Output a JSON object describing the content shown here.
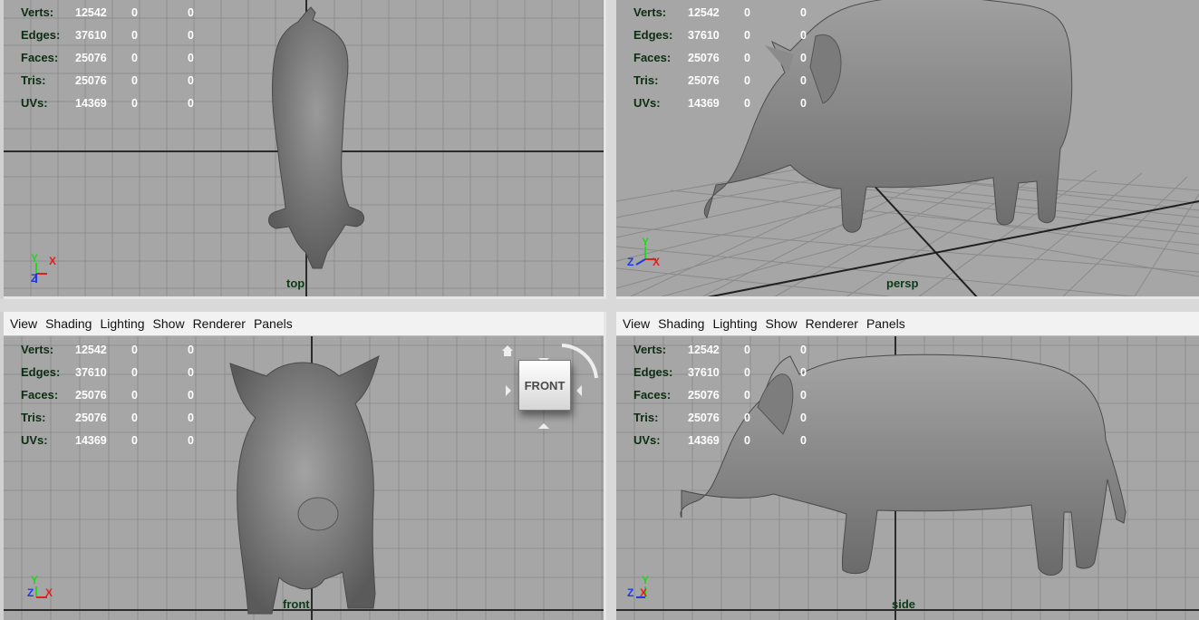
{
  "stats": [
    {
      "label": "Verts:",
      "v1": "12542",
      "v2": "0",
      "v3": "0"
    },
    {
      "label": "Edges:",
      "v1": "37610",
      "v2": "0",
      "v3": "0"
    },
    {
      "label": "Faces:",
      "v1": "25076",
      "v2": "0",
      "v3": "0"
    },
    {
      "label": "Tris:",
      "v1": "25076",
      "v2": "0",
      "v3": "0"
    },
    {
      "label": "UVs:",
      "v1": "14369",
      "v2": "0",
      "v3": "0"
    }
  ],
  "menu": [
    "View",
    "Shading",
    "Lighting",
    "Show",
    "Renderer",
    "Panels"
  ],
  "viewports": {
    "top": {
      "camera": "top"
    },
    "persp": {
      "camera": "persp"
    },
    "front": {
      "camera": "front"
    },
    "side": {
      "camera": "side"
    }
  },
  "viewcube": {
    "face_label": "FRONT"
  },
  "axis_labels": {
    "x": "X",
    "y": "Y",
    "z": "Z"
  },
  "colors": {
    "viewport_bg": "#a6a6a6",
    "grid": "#8d8d8d",
    "axis_line": "#2b2b2b",
    "hud_label": "#0c2d12",
    "hud_value": "#ffffff",
    "camera_label": "#0c3a16",
    "x_axis": "#e0201d",
    "y_axis": "#1fd81f",
    "z_axis": "#1e39e8",
    "model": "#7d7d7d"
  }
}
